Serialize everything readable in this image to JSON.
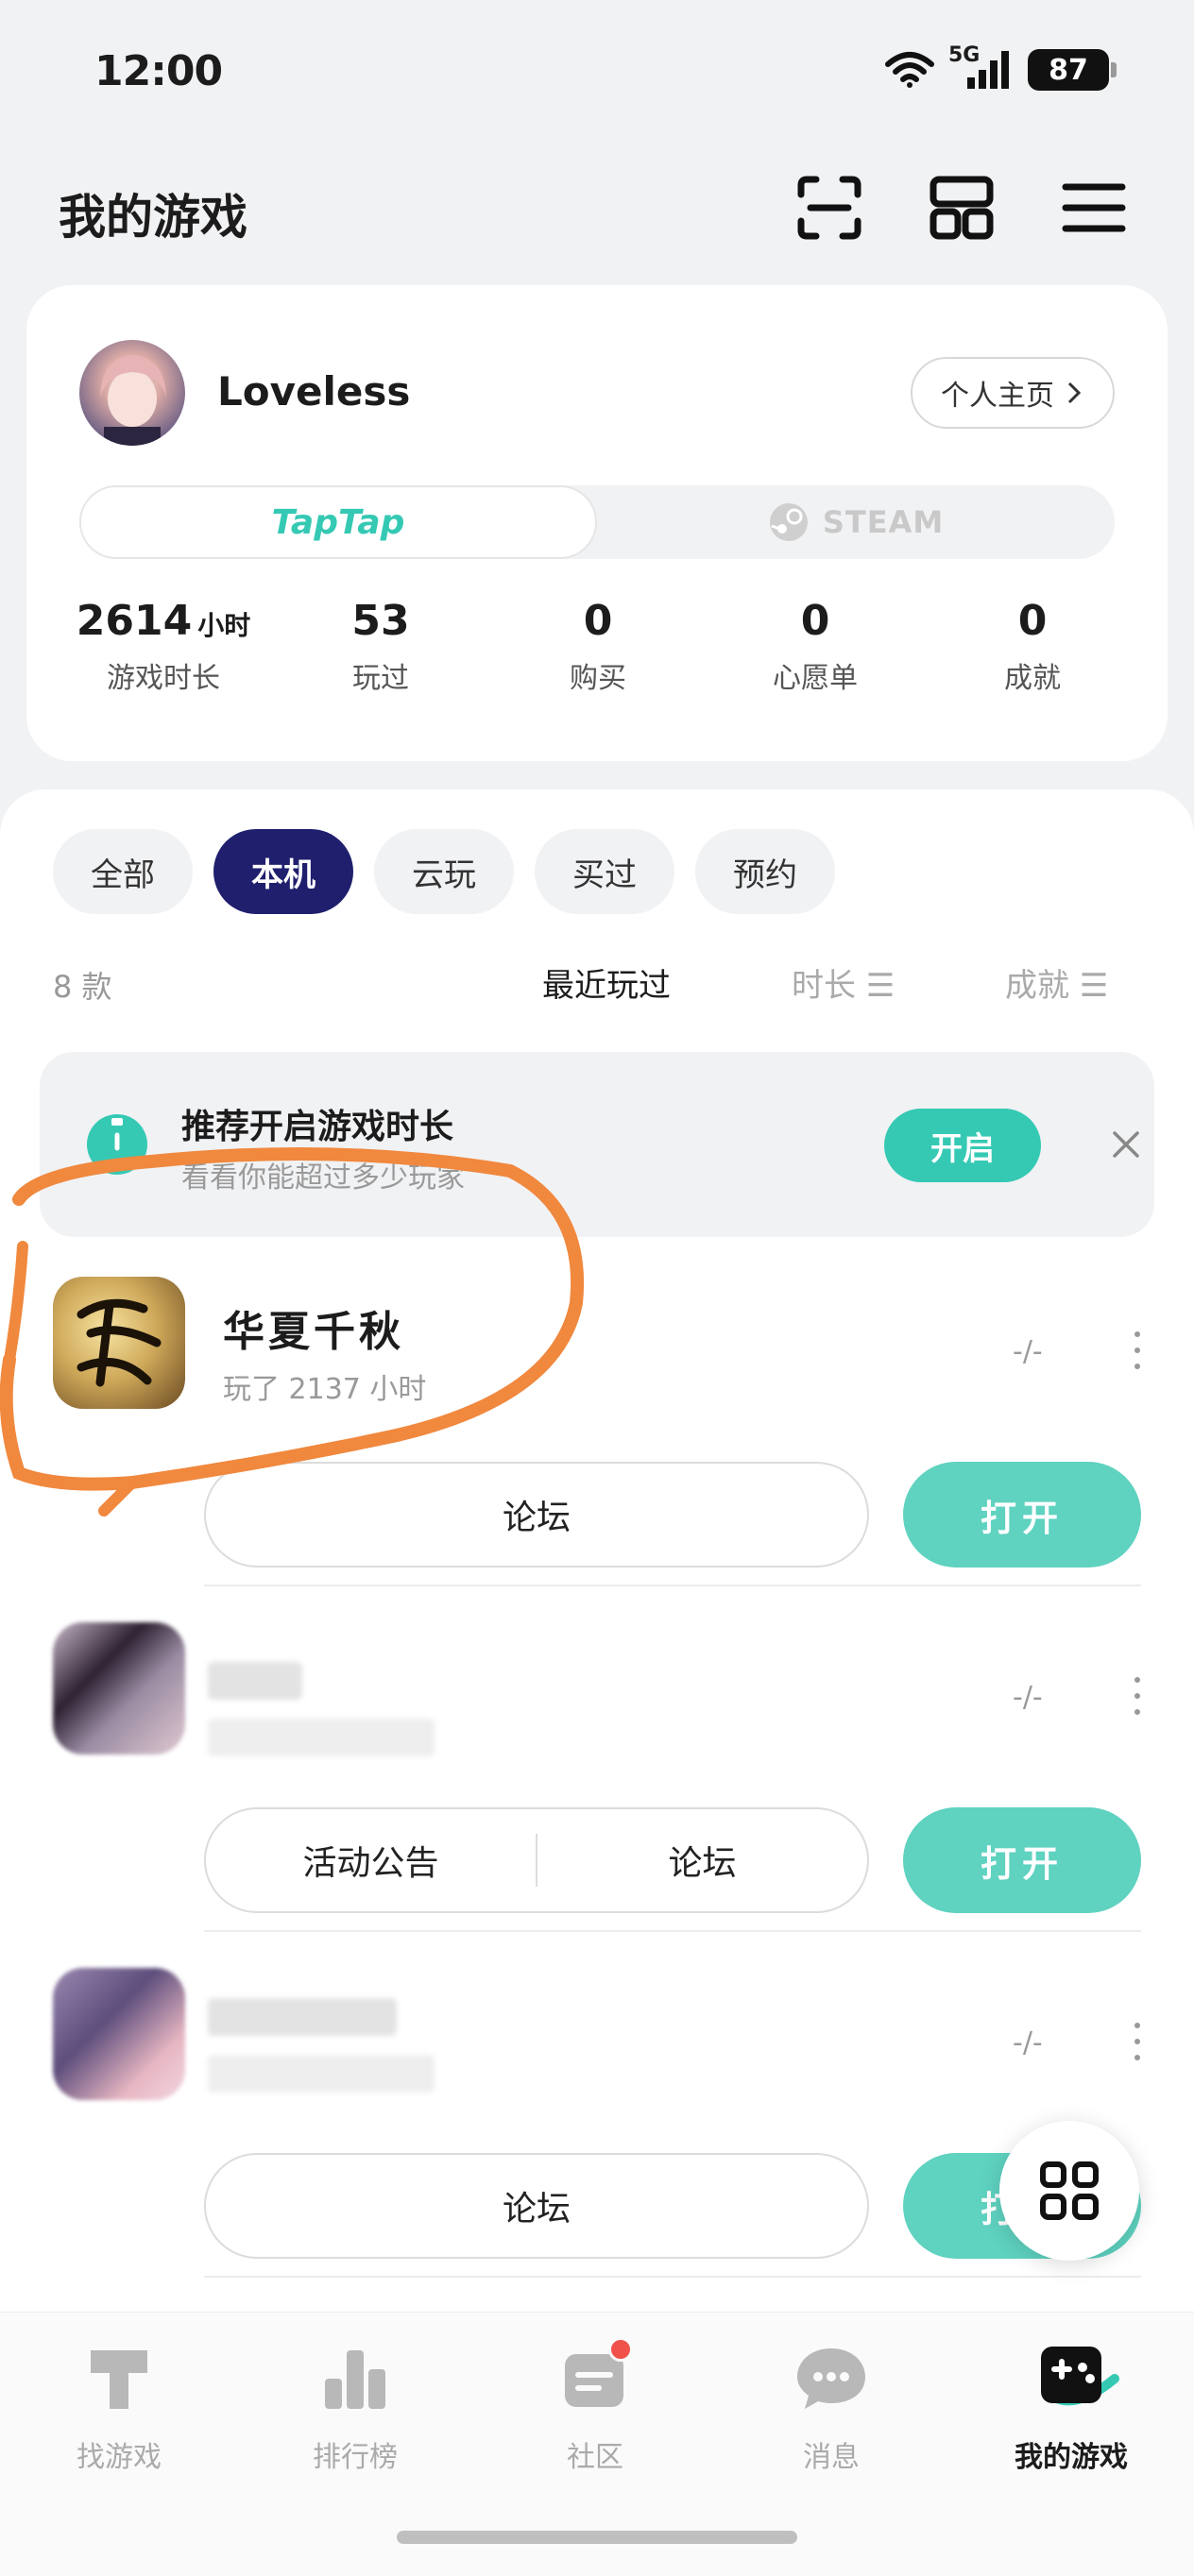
{
  "status_bar": {
    "time": "12:00",
    "network": "5G",
    "battery": "87"
  },
  "header": {
    "title": "我的游戏"
  },
  "profile": {
    "username": "Loveless",
    "homepage_label": "个人主页",
    "platforms": [
      "TapTap",
      "STEAM"
    ],
    "stats": [
      {
        "value": "2614",
        "unit": "小时",
        "label": "游戏时长"
      },
      {
        "value": "53",
        "unit": "",
        "label": "玩过"
      },
      {
        "value": "0",
        "unit": "",
        "label": "购买"
      },
      {
        "value": "0",
        "unit": "",
        "label": "心愿单"
      },
      {
        "value": "0",
        "unit": "",
        "label": "成就"
      }
    ]
  },
  "filters": [
    "全部",
    "本机",
    "云玩",
    "买过",
    "预约"
  ],
  "active_filter": "本机",
  "list_header": {
    "count": "8 款",
    "sort_recent": "最近玩过",
    "sort_duration": "时长",
    "sort_achievement": "成就"
  },
  "banner": {
    "title": "推荐开启游戏时长",
    "subtitle": "看看你能超过多少玩家",
    "button": "开启"
  },
  "games": [
    {
      "name": "华夏千秋",
      "subtitle": "玩了 2137 小时",
      "rating": "-/-",
      "actions": [
        "论坛"
      ],
      "open": "打开"
    },
    {
      "name": "",
      "subtitle": "",
      "rating": "-/-",
      "actions": [
        "活动公告",
        "论坛"
      ],
      "open": "打开"
    },
    {
      "name": "",
      "subtitle": "",
      "rating": "-/-",
      "actions": [
        "论坛"
      ],
      "open": "打开"
    }
  ],
  "nav": [
    {
      "label": "找游戏",
      "icon": "find-games-icon"
    },
    {
      "label": "排行榜",
      "icon": "ranking-icon"
    },
    {
      "label": "社区",
      "icon": "community-icon"
    },
    {
      "label": "消息",
      "icon": "message-icon"
    },
    {
      "label": "我的游戏",
      "icon": "my-games-icon"
    }
  ],
  "colors": {
    "accent": "#35c9b4",
    "chip_active": "#1f1f6e",
    "annotation": "#f0883e",
    "badge": "#f0514b"
  }
}
